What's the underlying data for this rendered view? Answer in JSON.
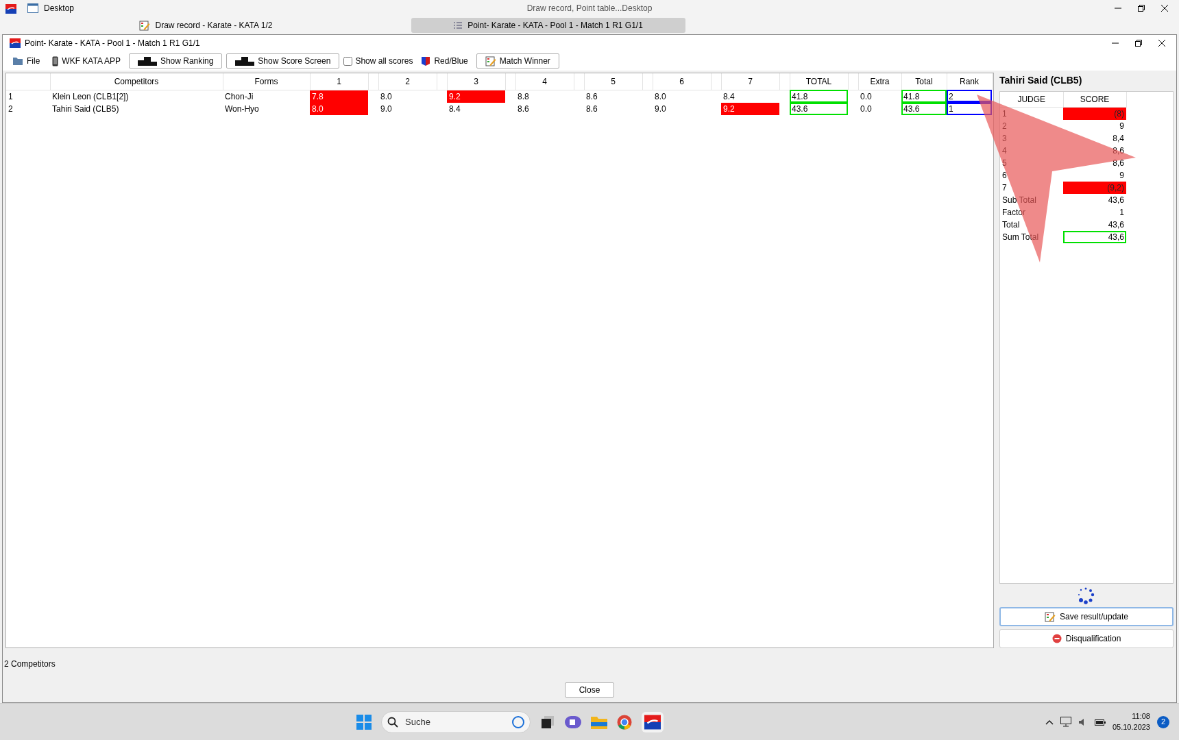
{
  "os_bar": {
    "title": "Desktop",
    "center_title": "Draw record, Point table...Desktop"
  },
  "doc_tabs": [
    {
      "label": "Draw record - Karate - KATA 1/2",
      "selected": false
    },
    {
      "label": "Point- Karate - KATA - Pool 1 - Match 1 R1 G1/1",
      "selected": true
    }
  ],
  "window": {
    "title": "Point- Karate - KATA - Pool 1 - Match 1 R1 G1/1"
  },
  "toolbar": [
    {
      "kind": "menu",
      "label": "File"
    },
    {
      "kind": "menu",
      "label": "WKF KATA APP"
    },
    {
      "kind": "button",
      "label": "Show Ranking"
    },
    {
      "kind": "button",
      "label": "Show Score Screen"
    },
    {
      "kind": "checkbox",
      "label": "Show all scores",
      "checked": false
    },
    {
      "kind": "menu",
      "label": "Red/Blue"
    },
    {
      "kind": "button",
      "label": "Match Winner"
    }
  ],
  "table": {
    "columns": [
      "Competitors",
      "Forms",
      "1",
      "2",
      "3",
      "4",
      "5",
      "6",
      "7",
      "TOTAL",
      "Extra",
      "Total",
      "Rank"
    ],
    "rows": [
      {
        "num": "1",
        "name": "Klein Leon (CLB1[2])",
        "form": "Chon-Ji",
        "scores": [
          {
            "value": "7.8",
            "dropped": true
          },
          {
            "value": "8.0",
            "dropped": false
          },
          {
            "value": "9.2",
            "dropped": true
          },
          {
            "value": "8.8",
            "dropped": false
          },
          {
            "value": "8.6",
            "dropped": false
          },
          {
            "value": "8.0",
            "dropped": false
          },
          {
            "value": "8.4",
            "dropped": false
          }
        ],
        "total": "41.8",
        "extra": "0.0",
        "final": "41.8",
        "rank": "2",
        "selected": false
      },
      {
        "num": "2",
        "name": "Tahiri Said (CLB5)",
        "form": "Won-Hyo",
        "scores": [
          {
            "value": "8.0",
            "dropped": true
          },
          {
            "value": "9.0",
            "dropped": false
          },
          {
            "value": "8.4",
            "dropped": false
          },
          {
            "value": "8.6",
            "dropped": false
          },
          {
            "value": "8.6",
            "dropped": false
          },
          {
            "value": "9.0",
            "dropped": false
          },
          {
            "value": "9.2",
            "dropped": true
          }
        ],
        "total": "43.6",
        "extra": "0.0",
        "final": "43.6",
        "rank": "1",
        "selected": true
      }
    ]
  },
  "detail": {
    "title": "Tahiri Said (CLB5)",
    "columns": [
      "JUDGE",
      "SCORE"
    ],
    "rows": [
      {
        "label": "1",
        "score": "(8)",
        "kind": "dropped"
      },
      {
        "label": "2",
        "score": "9",
        "kind": "plain"
      },
      {
        "label": "3",
        "score": "8,4",
        "kind": "plain"
      },
      {
        "label": "4",
        "score": "8,6",
        "kind": "plain"
      },
      {
        "label": "5",
        "score": "8,6",
        "kind": "plain"
      },
      {
        "label": "6",
        "score": "9",
        "kind": "plain"
      },
      {
        "label": "7",
        "score": "(9,2)",
        "kind": "dropped"
      },
      {
        "label": "Sub Total",
        "score": "43,6",
        "kind": "plain"
      },
      {
        "label": "Factor",
        "score": "1",
        "kind": "plain"
      },
      {
        "label": "Total",
        "score": "43,6",
        "kind": "plain"
      },
      {
        "label": "Sum Total",
        "score": "43,6",
        "kind": "sum"
      }
    ],
    "buttons": [
      {
        "label": "Save result/update",
        "focused": true
      },
      {
        "label": "Disqualification",
        "focused": false
      }
    ]
  },
  "status": "2 Competitors",
  "close_button": "Close",
  "taskbar": {
    "search_placeholder": "Suche",
    "time": "11:08",
    "date": "05.10.2023",
    "badge": "2"
  }
}
